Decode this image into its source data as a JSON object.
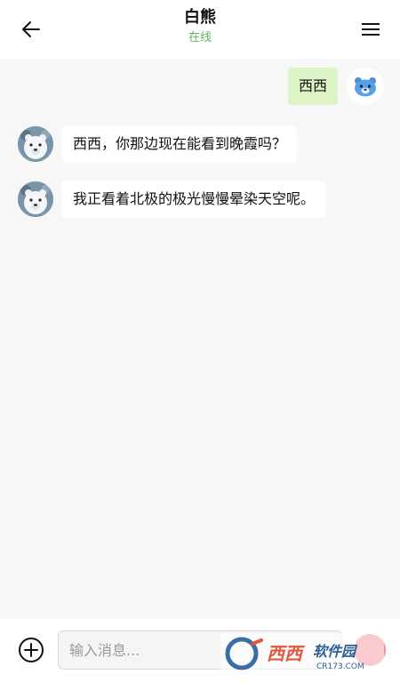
{
  "header": {
    "title": "白熊",
    "status": "在线",
    "status_color": "#5cb85c"
  },
  "messages": [
    {
      "side": "right",
      "text": "西西",
      "avatar": "bear-face-icon"
    },
    {
      "side": "left",
      "text": "西西，你那边现在能看到晚霞吗？",
      "avatar": "polar-bear-avatar"
    },
    {
      "side": "left",
      "text": "我正看着北极的极光慢慢晕染天空呢。",
      "avatar": "polar-bear-avatar"
    }
  ],
  "input": {
    "placeholder": "输入消息..."
  },
  "watermark": {
    "text": "西西软件园",
    "domain": "CR173.com"
  },
  "colors": {
    "mine_bubble": "#dcf3c5",
    "other_bubble": "#ffffff",
    "chat_bg": "#f7f7f7",
    "send_button": "#f28b93"
  }
}
